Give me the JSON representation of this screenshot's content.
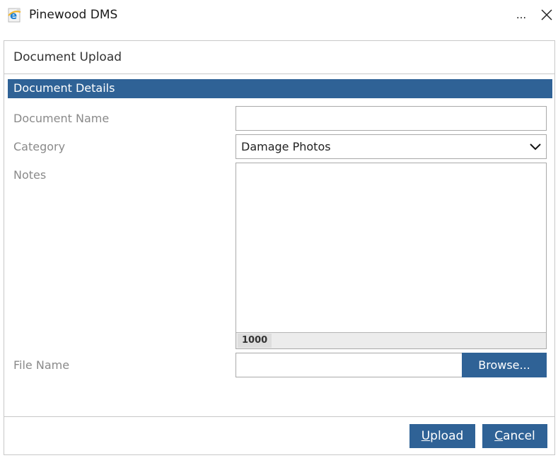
{
  "window": {
    "title": "Pinewood DMS",
    "more_label": "...",
    "app_icon": "ie-icon",
    "close_icon": "close-icon"
  },
  "dialog": {
    "title": "Document Upload",
    "section_title": "Document Details",
    "fields": {
      "document_name": {
        "label": "Document Name",
        "value": ""
      },
      "category": {
        "label": "Category",
        "value": "Damage Photos"
      },
      "notes": {
        "label": "Notes",
        "value": "",
        "char_count": "1000"
      },
      "file_name": {
        "label": "File Name",
        "value": ""
      }
    },
    "browse_label": "Browse...",
    "upload_accel": "U",
    "upload_rest": "pload",
    "cancel_accel": "C",
    "cancel_rest": "ancel"
  },
  "colors": {
    "accent": "#2f6296",
    "label": "#8a8a8a",
    "border": "#a9a9a9"
  }
}
